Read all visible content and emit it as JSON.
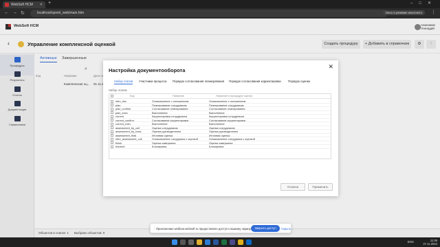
{
  "browser": {
    "tab_title": "WebSoft HCM",
    "url": "localhost/spxml_web/main.htm",
    "guest_label": "Окно в режиме инкогнито"
  },
  "app": {
    "brand": "WebSoft HCM",
    "user_line1": "Анисимов",
    "user_line2": "Геннадий"
  },
  "page": {
    "title": "Управление комплексной оценкой",
    "create_button": "Создать процедуру",
    "add_button": "Добавить в справочник"
  },
  "sidebar": {
    "items": [
      {
        "label": "Процедуры",
        "icon": "procedures-icon"
      },
      {
        "label": "Результаты",
        "icon": "results-icon"
      },
      {
        "label": "Отчеты",
        "icon": "reports-icon"
      },
      {
        "label": "Документация",
        "icon": "documentation-icon"
      },
      {
        "label": "Справочники",
        "icon": "directories-icon"
      }
    ]
  },
  "content": {
    "tabs": [
      "Активные",
      "Завершенные"
    ],
    "columns": [
      "Код",
      "Название",
      "Дата на"
    ],
    "row": {
      "name": "Комплексная оц...",
      "date": "01.11.20"
    },
    "status_count": "Объектов в списке: 1",
    "status_selected": "Выбрано объектов: 0"
  },
  "modal": {
    "title": "Настройка документооборота",
    "tabs": [
      "Набор этапов",
      "Участники процесса",
      "Порядок согласования планирования",
      "Порядок согласования корректировки",
      "Порядок оценки"
    ],
    "set_label": "Набор этапов",
    "headers": [
      "Код",
      "Название",
      "Название в процедуре оценки"
    ],
    "rows": [
      {
        "code": "intro_doc",
        "name": "Ознакомление с положением",
        "proc_name": "Ознакомление с положением"
      },
      {
        "code": "plan",
        "name": "Планирование сотрудником",
        "proc_name": "Планирование сотрудником"
      },
      {
        "code": "plan_confirm",
        "name": "Согласование планирования",
        "proc_name": "Согласование планирования"
      },
      {
        "code": "plan_exec",
        "name": "Выполнение",
        "proc_name": "Выполнение"
      },
      {
        "code": "correct",
        "name": "Корректировка сотрудником",
        "proc_name": "Корректировка сотрудником"
      },
      {
        "code": "correct_confirm",
        "name": "Согласование корректировки",
        "proc_name": "Согласование корректировки"
      },
      {
        "code": "correct_exec",
        "name": "Выполнение",
        "proc_name": "Выполнение"
      },
      {
        "code": "assessment_by_coll",
        "name": "Оценка сотрудником",
        "proc_name": "Оценка сотрудником"
      },
      {
        "code": "assessment_by_boss",
        "name": "Оценка руководителем",
        "proc_name": "Оценка руководителем"
      },
      {
        "code": "assessment_final",
        "name": "Итоговая оценка",
        "proc_name": "Итоговая оценка"
      },
      {
        "code": "intro_assessment_coll",
        "name": "Ознакомление сотрудника с оценкой",
        "proc_name": "Ознакомление сотрудника с оценкой"
      },
      {
        "code": "finish",
        "name": "Оценка завершена",
        "proc_name": "Оценка завершена"
      },
      {
        "code": "blocked",
        "name": "Блокировка",
        "proc_name": "Блокировка"
      }
    ],
    "cancel_button": "Отмена",
    "apply_button": "Применить"
  },
  "notification": {
    "text": "Приложению webloar.websoft.ru предоставлен доступ к вашему экрану.",
    "open_button": "Закрыть доступ",
    "hide_link": "Скрыть"
  },
  "taskbar": {
    "language": "ENG",
    "time": "11:09",
    "date": "27.11.2024"
  },
  "colors": {
    "accent": "#2f6bd6",
    "page_icon": "#f0c040",
    "brand_red": "#cc3333"
  }
}
